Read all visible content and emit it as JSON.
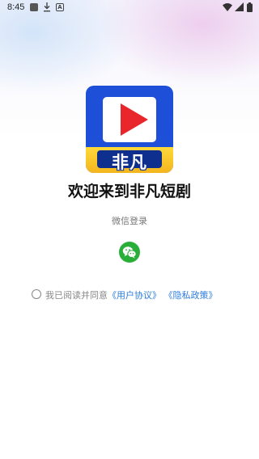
{
  "status_bar": {
    "time": "8:45",
    "icons": [
      "notification-square-icon",
      "download-icon",
      "a-icon",
      "wifi-icon",
      "signal-icon",
      "battery-icon"
    ],
    "a_glyph": "A"
  },
  "logo": {
    "text": "非凡",
    "colors": {
      "background": "#1e4fd8",
      "play": "#e8262b",
      "band": "#ffd93b"
    }
  },
  "welcome": {
    "title": "欢迎来到非凡短剧"
  },
  "login": {
    "wechat_label": "微信登录",
    "wechat_icon": "wechat-icon",
    "wechat_color": "#2aae3a"
  },
  "agreement": {
    "prefix": "我已阅读并同意",
    "user_agreement": "《用户协议》",
    "privacy_policy": "《隐私政策》",
    "link_color": "#2b7de1"
  }
}
